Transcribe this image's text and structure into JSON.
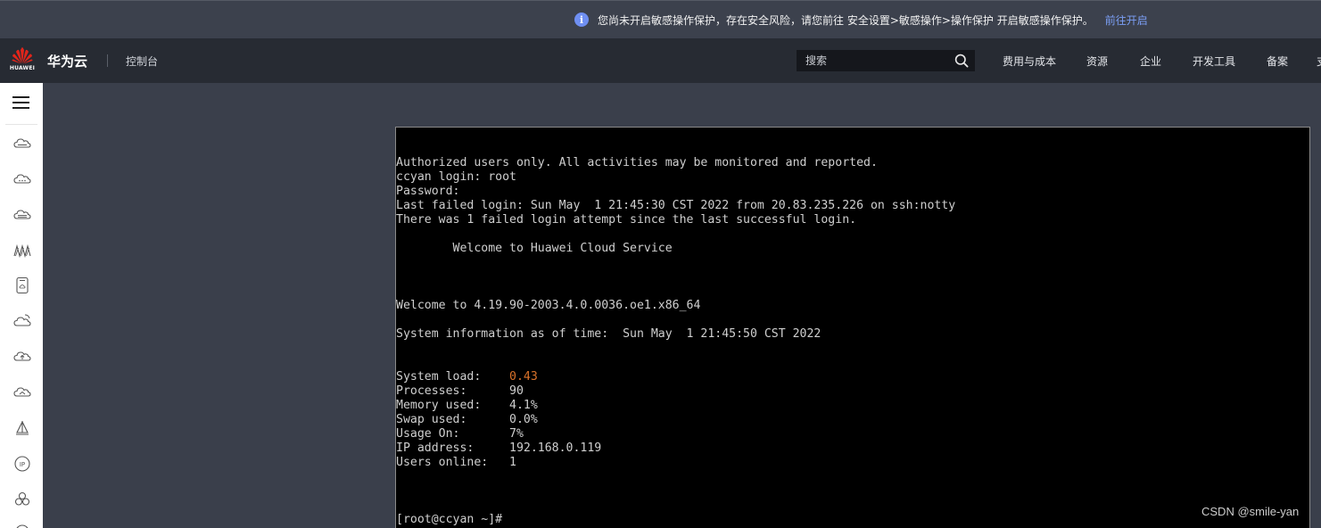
{
  "notice": {
    "message": "您尚未开启敏感操作保护，存在安全风险，请您前往 安全设置>敏感操作>操作保护 开启敏感操作保护。",
    "link": "前往开启",
    "icon": "info-icon"
  },
  "header": {
    "logo_text": "HUAWEI",
    "brand": "华为云",
    "console": "控制台",
    "search_placeholder": "搜索",
    "nav": [
      "费用与成本",
      "资源",
      "企业",
      "开发工具",
      "备案"
    ],
    "nav_overflow": "支"
  },
  "sidebar": {
    "icons": [
      "cloud-server-icon",
      "cloud-icon",
      "cloud-database-icon",
      "network-icon",
      "storage-icon",
      "cloud-refresh-icon",
      "cloud-upload-icon",
      "cloud-sync-icon",
      "sailboat-icon",
      "ip-icon",
      "cluster-icon"
    ]
  },
  "terminal": {
    "lines": [
      "Authorized users only. All activities may be monitored and reported.",
      "ccyan login: root",
      "Password:",
      "Last failed login: Sun May  1 21:45:30 CST 2022 from 20.83.235.226 on ssh:notty",
      "There was 1 failed login attempt since the last successful login.",
      "",
      "        Welcome to Huawei Cloud Service",
      "",
      "",
      "",
      "Welcome to 4.19.90-2003.4.0.0036.oe1.x86_64",
      "",
      "System information as of time:  Sun May  1 21:45:50 CST 2022",
      "",
      "",
      "Processes:      90",
      "Memory used:    4.1%",
      "Swap used:      0.0%",
      "Usage On:       7%",
      "IP address:     192.168.0.119",
      "Users online:   1",
      "",
      "",
      "",
      "[root@ccyan ~]#"
    ],
    "system_load_label": "System load:    ",
    "system_load_value": "0.43"
  },
  "watermark": "CSDN @smile-yan",
  "colors": {
    "notice_bg": "#3c414d",
    "header_bg": "#272b33",
    "content_bg": "#3a3f4b",
    "terminal_bg": "#000000",
    "terminal_text": "#cfcfcf",
    "highlight": "#d9722a",
    "link": "#7b9ff5",
    "brand_red": "#e1251b"
  }
}
